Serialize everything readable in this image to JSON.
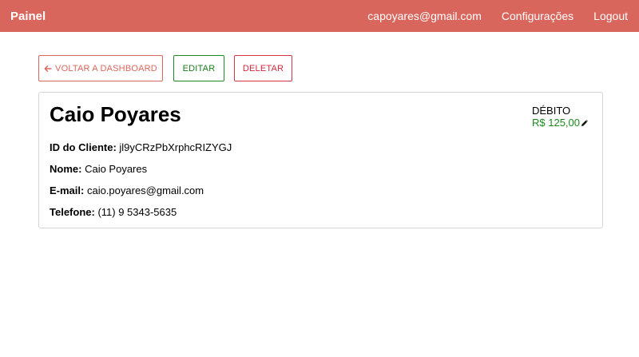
{
  "navbar": {
    "brand": "Painel",
    "user_email": "capoyares@gmail.com",
    "settings_label": "Configurações",
    "logout_label": "Logout",
    "color": "#d9665c"
  },
  "actions": {
    "back_label": "VOLTAR A DASHBOARD",
    "edit_label": "EDITAR",
    "delete_label": "DELETAR"
  },
  "client": {
    "name": "Caio Poyares",
    "debt_label": "DÉBITO",
    "debt_value": "R$ 125,00",
    "fields": [
      {
        "label": "ID do Cliente:",
        "value": "jl9yCRzPbXrphcRIZYGJ"
      },
      {
        "label": "Nome:",
        "value": "Caio Poyares"
      },
      {
        "label": "E-mail:",
        "value": "caio.poyares@gmail.com"
      },
      {
        "label": "Telefone:",
        "value": "(11) 9 5343-5635"
      }
    ]
  },
  "icons": {
    "back": "arrow-left-icon",
    "edit_debt": "pencil-icon"
  }
}
